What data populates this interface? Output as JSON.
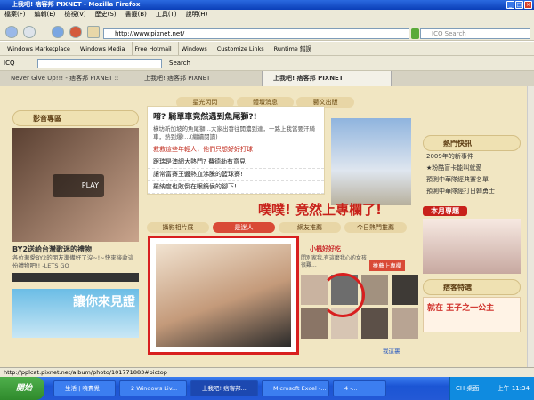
{
  "window": {
    "title": "上我吧! 痞客邦 PIXNET - Mozilla Firefox"
  },
  "menu": [
    "檔案(F)",
    "編輯(E)",
    "檢視(V)",
    "歷史(S)",
    "書籤(B)",
    "工具(T)",
    "說明(H)"
  ],
  "nav": {
    "url": "http://www.pixnet.net/",
    "search_placeholder": "ICQ Search"
  },
  "bookmarks": [
    "Windows Marketplace",
    "Windows Media",
    "Free Hotmail",
    "Windows",
    "Customize Links",
    "Runtime 錯誤"
  ],
  "icq": {
    "label": "ICQ",
    "search_label": "Search"
  },
  "tabs": [
    "Never Give Up!!! - 痞客邦 PIXNET ::",
    "上我吧! 痞客邦 PIXNET",
    "上我吧! 痞客邦 PIXNET"
  ],
  "page": {
    "top_tabs": [
      "星光閃閃",
      "體壇消息",
      "藝文出版"
    ],
    "video_header": "影音專區",
    "play_label": "PLAY",
    "video_caption": "BY2送給台灣歌迷的禮物",
    "video_desc": "各位著愛BY2的朋友準備好了沒~!~快來接收這份禮物吧!! -LETS GO",
    "banner_text": "讓你來見證",
    "headline": "唷? 騎單車竟然遇到魚尾獅?!",
    "headline_body": "橫坊新加坡的魚尾獅…大家出發往開濃到達，一路上我當要汗騎車，熱到爆!…(繼續閱讀)",
    "news": [
      "救救這些年輕人，他們只想好好打球",
      "跟瑞是澳網大熱門? 費德勒有意見",
      "讓常富賽王醬熱血沸騰的籃球賽!",
      "羅納度也敗倒在眼鏡侯的腳下!"
    ],
    "sub_tabs": [
      "攝影相片展",
      "是迷人",
      "網友推薦",
      "今日熱門推薦"
    ],
    "annotation": "噗噗! 竟然上專欄了!",
    "small_label": "小楓好好吃",
    "small_desc": "問別家我,有這麼我心的女孩很難...",
    "push_label": "推薦上專欄",
    "side_headers": {
      "hot": "熱門快訊",
      "special": "痞客特選"
    },
    "hot_items": [
      "2009年的新事件",
      "★粉酷盲卡能叫就愛",
      "預測中華隊經典賽名單",
      "預測中華隊經打日韓勇士"
    ],
    "month_label": "本月專題",
    "princess_label": "就在 王子之一公主",
    "more_label": "我這裏"
  },
  "status": {
    "url": "http://pplcat.pixnet.net/album/photo/101771883#pictop"
  },
  "taskbar": {
    "start": "開始",
    "items": [
      "生活 | 噴費覺",
      "2 Windows Liv...",
      "上我吧! 痞客邦...",
      "Microsoft Excel -...",
      "4 -..."
    ],
    "ime": "CH 桌面",
    "clock": "上午 11:34"
  }
}
